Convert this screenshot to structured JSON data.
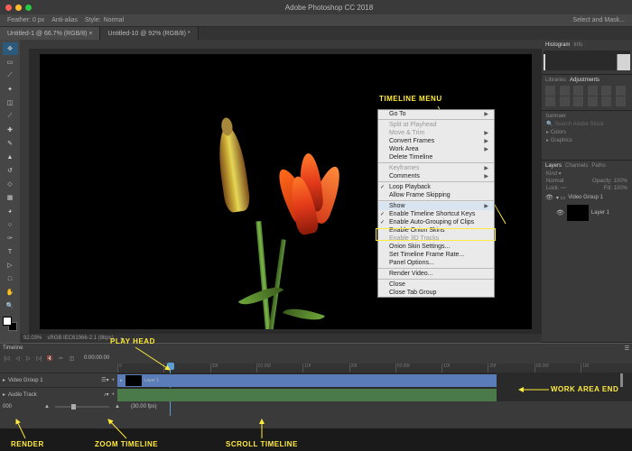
{
  "titlebar": {
    "title": "Adobe Photoshop CC 2018"
  },
  "options": {
    "feather": "Feather: 0 px",
    "antialias": "Anti-alias",
    "style_label": "Style:",
    "style_value": "Normal",
    "select_mask": "Select and Mask..."
  },
  "tabs": {
    "t1": "Untitled-1 @ 66.7% (RGB/8) ×",
    "t2": "Untitled-10 @ 92% (RGB/8) *"
  },
  "status": {
    "zoom": "92.03%",
    "profile": "sRGB IEC61966-2.1 (8bpc)"
  },
  "panels": {
    "histogram_tab": "Histogram",
    "info_tab": "Info",
    "libraries_tab": "Libraries",
    "adjustments_tab": "Adjustments",
    "lib_dropdown": "bannaer",
    "lib_search_placeholder": "Search Adobe Stock",
    "lib_colors": "Colors",
    "lib_graphics": "Graphics",
    "layers_tab": "Layers",
    "channels_tab": "Channels",
    "paths_tab": "Paths",
    "kind": "Kind",
    "blend": "Normal",
    "opacity_label": "Opacity:",
    "opacity": "100%",
    "lock_label": "Lock:",
    "fill_label": "Fill:",
    "fill": "100%",
    "group": "Video Group 1",
    "layer": "Layer 1"
  },
  "timeline": {
    "header": "Timeline",
    "ticks": [
      "0",
      "10f",
      "20f",
      "01:00f",
      "10f",
      "20f",
      "02:00f",
      "10f",
      "20f",
      "03:00f",
      "10f"
    ],
    "video_group": "Video Group 1",
    "audio_track": "Audio Track",
    "layer_clip": "Layer 1",
    "frame_label": "000",
    "fps": "(30.00 fps)",
    "timecode": "0:00:00:00"
  },
  "menu": {
    "goto": "Go To",
    "split": "Split at Playhead",
    "move_trim": "Move & Trim",
    "convert": "Convert Frames",
    "workarea": "Work Area",
    "delete": "Delete Timeline",
    "keyframes": "Keyframes",
    "comments": "Comments",
    "loop": "Loop Playback",
    "skip": "Allow Frame Skipping",
    "show": "Show",
    "shortcut": "Enable Timeline Shortcut Keys",
    "autogroup": "Enable Auto-Grouping of Clips",
    "onion": "Enable Onion Skins",
    "tracks3d": "Enable 3D Tracks",
    "onion_settings": "Onion Skin Settings...",
    "framerate": "Set Timeline Frame Rate...",
    "panel_opts": "Panel Options...",
    "render": "Render Video...",
    "close": "Close",
    "closegroup": "Close Tab Group"
  },
  "annotations": {
    "timeline_menu": "TIMELINE MENU",
    "play_head": "PLAY HEAD",
    "work_area_end": "WORK AREA END",
    "render": "RENDER",
    "zoom_timeline": "ZOOM TIMELINE",
    "scroll_timeline": "SCROLL TIMELINE"
  }
}
